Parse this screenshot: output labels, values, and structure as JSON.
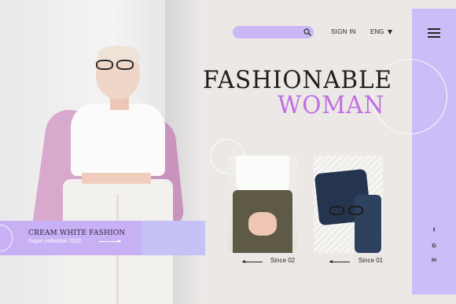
{
  "header": {
    "search_placeholder": "",
    "sign_in_label": "SIGN IN",
    "language_label": "ENG"
  },
  "hero": {
    "headline_line1": "FASHIONABLE",
    "headline_line2": "WOMAN"
  },
  "promo": {
    "title": "CREAM WHITE FASHION",
    "subtitle": "Super collection 2022"
  },
  "products": [
    {
      "since_label": "Since 02"
    },
    {
      "since_label": "Since 01"
    }
  ],
  "social": [
    {
      "icon": "facebook-icon",
      "glyph": "f"
    },
    {
      "icon": "google-icon",
      "glyph": "G"
    },
    {
      "icon": "linkedin-icon",
      "glyph": "in"
    }
  ],
  "colors": {
    "background": "#ece8e5",
    "accent_lavender": "#ccbdf9",
    "accent_purple_text": "#c06ee3",
    "promo_left": "#c7b1f4",
    "promo_right": "#c5c3f6",
    "text_dark": "#2a2523"
  }
}
